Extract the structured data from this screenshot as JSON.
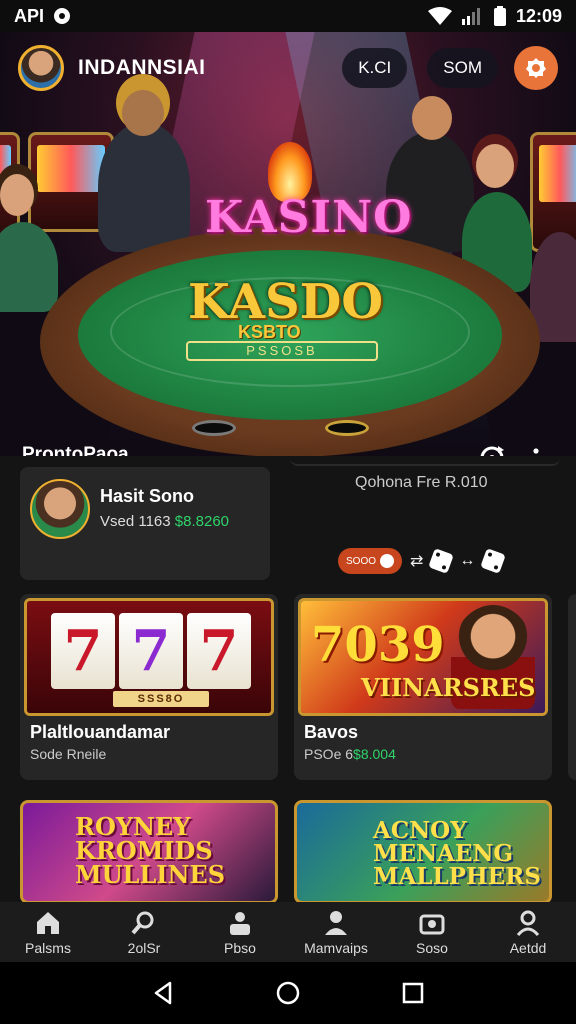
{
  "status_bar": {
    "carrier": "API",
    "time": "12:09"
  },
  "header": {
    "brand": "INDANNSIAI",
    "pill_1": "K.CI",
    "pill_2": "SOM"
  },
  "hero": {
    "logo_top": "KASINO",
    "logo_main": "KASDO",
    "logo_sub": "KSBTO",
    "felt_plate": "PSSOSB",
    "caption": "ProntoPaoa"
  },
  "profile": {
    "name": "Hasit Sono",
    "sub_text": "Vsed 1163",
    "sub_amount": "$8.8260"
  },
  "side_info": {
    "title": "Qohona Fre R.010",
    "badge": "SOOO"
  },
  "games": [
    {
      "thumb_plate": "SSS8O",
      "title": "Plaltlouandamar",
      "sub": "Sode Rneile",
      "amount": ""
    },
    {
      "thumb_text": "VIINARSRES",
      "thumb_num": "7039",
      "title": "Bavos",
      "sub": "PSOe 6",
      "amount": "$8.004"
    }
  ],
  "promos": [
    {
      "lines": [
        "ROYNEY",
        "KROMIDS",
        "MULLINES"
      ]
    },
    {
      "lines": [
        "ACNOY",
        "MENAENG",
        "MALLPHERS"
      ]
    }
  ],
  "bottom_nav": [
    {
      "label": "Palsms",
      "icon": "home-icon"
    },
    {
      "label": "2olSr",
      "icon": "search-person-icon"
    },
    {
      "label": "Pbso",
      "icon": "people-icon"
    },
    {
      "label": "Mamvaips",
      "icon": "person-icon"
    },
    {
      "label": "Soso",
      "icon": "camera-icon"
    },
    {
      "label": "Aetdd",
      "icon": "profile-icon"
    }
  ],
  "colors": {
    "accent_orange": "#e8743a",
    "gold": "#f0b030",
    "green_amount": "#2fd36a",
    "card_bg": "#262626"
  }
}
